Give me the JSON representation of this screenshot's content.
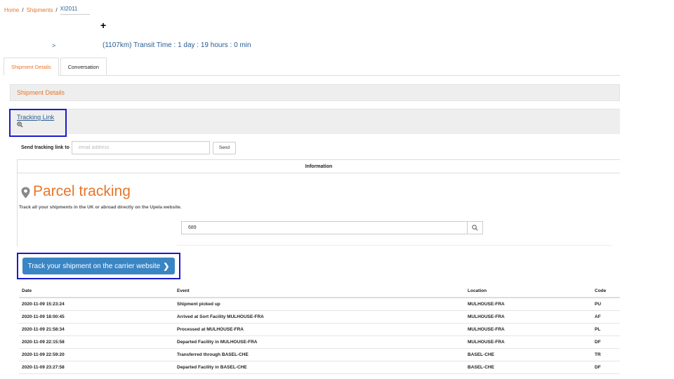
{
  "breadcrumb": {
    "home": "Home",
    "shipments": "Shipments",
    "current": "XI2011"
  },
  "route": {
    "plus": "+",
    "arrow": ">",
    "transit": "(1107km) Transit Time : 1 day : 19 hours : 0 min"
  },
  "tabs": [
    {
      "label": "Shipment Details"
    },
    {
      "label": "Conversation"
    }
  ],
  "panel_title": "Shipment Details",
  "tracking_link": "Tracking Link",
  "send": {
    "label": "Send tracking link to",
    "placeholder": "email address",
    "button": "Send"
  },
  "information_header": "Information",
  "parcel": {
    "title": "Parcel tracking",
    "subtitle": "Track all your shipments in the UK or abroad directly on the Upela website.",
    "search_value": "689"
  },
  "carrier_button": "Track your shipment on the carrier website",
  "table": {
    "headers": {
      "date": "Date",
      "event": "Event",
      "location": "Location",
      "code": "Code"
    },
    "rows": [
      {
        "date": "2020-11-09 15:23:24",
        "event": "Shipment picked up",
        "location": "MULHOUSE-FRA",
        "code": "PU"
      },
      {
        "date": "2020-11-09 18:00:45",
        "event": "Arrived at Sort Facility MULHOUSE-FRA",
        "location": "MULHOUSE-FRA",
        "code": "AF"
      },
      {
        "date": "2020-11-09 21:58:34",
        "event": "Processed at MULHOUSE-FRA",
        "location": "MULHOUSE-FRA",
        "code": "PL"
      },
      {
        "date": "2020-11-09 22:15:58",
        "event": "Departed Facility in MULHOUSE-FRA",
        "location": "MULHOUSE-FRA",
        "code": "DF"
      },
      {
        "date": "2020-11-09 22:59:20",
        "event": "Transferred through BASEL-CHE",
        "location": "BASEL-CHE",
        "code": "TR"
      },
      {
        "date": "2020-11-09 23:27:58",
        "event": "Departed Facility in BASEL-CHE",
        "location": "BASEL-CHE",
        "code": "DF"
      }
    ]
  },
  "colors": {
    "accent": "#e8752a",
    "link": "#2a5d93",
    "button": "#3a85c4",
    "highlight": "#1a1acc"
  },
  "icons": {
    "map_pin": "map-pin-icon",
    "magnifier": "zoom-icon",
    "search": "search-icon",
    "chevron": "chevron-right-icon"
  }
}
